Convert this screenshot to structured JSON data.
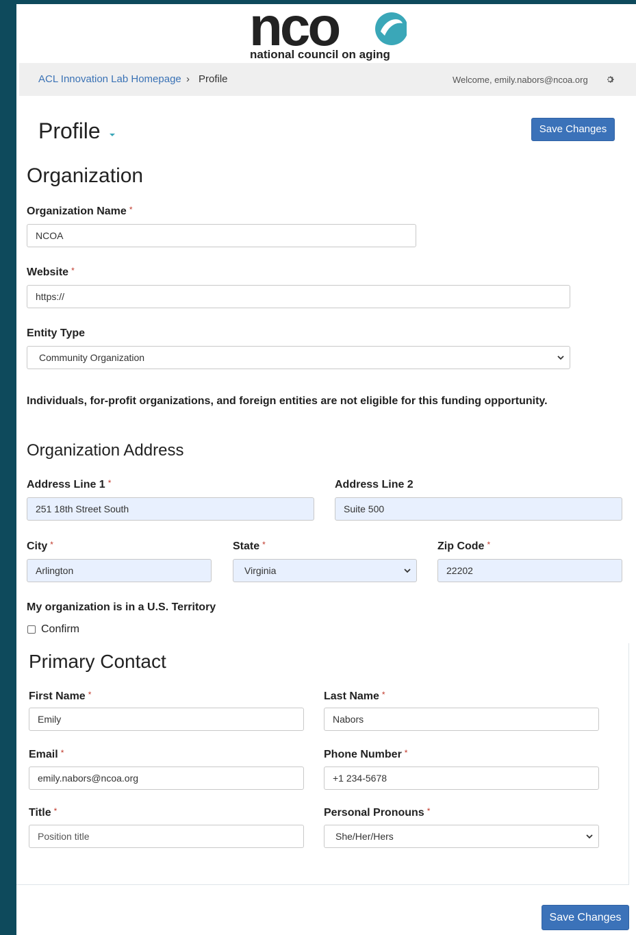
{
  "brand": {
    "logo_text": "nco",
    "tagline": "national council on aging",
    "accent_color": "#3aa7b8",
    "primary_color": "#3b72b9",
    "background_color": "#0e4a5c"
  },
  "navbar": {
    "breadcrumb_home": "ACL Innovation Lab Homepage",
    "breadcrumb_separator": "›",
    "breadcrumb_current": "Profile",
    "welcome_text": "Welcome, emily.nabors@ncoa.org",
    "settings_icon": "gear-icon"
  },
  "page": {
    "title": "Profile",
    "save_label": "Save Changes"
  },
  "organization": {
    "heading": "Organization",
    "name_label": "Organization Name",
    "name_value": "NCOA",
    "website_label": "Website",
    "website_value": "https://",
    "entity_label": "Entity Type",
    "entity_value": "Community Organization",
    "eligibility_note": "Individuals, for-profit organizations, and foreign entities are not eligible for this funding opportunity."
  },
  "address": {
    "heading": "Organization Address",
    "line1_label": "Address Line 1",
    "line1_value": "251 18th Street South",
    "line2_label": "Address Line 2",
    "line2_value": "Suite 500",
    "city_label": "City",
    "city_value": "Arlington",
    "state_label": "State",
    "state_value": "Virginia",
    "zip_label": "Zip Code",
    "zip_value": "22202",
    "territory_label": "My organization is in a U.S. Territory",
    "confirm_label": "Confirm"
  },
  "contact": {
    "heading": "Primary Contact",
    "first_label": "First Name",
    "first_value": "Emily",
    "last_label": "Last Name",
    "last_value": "Nabors",
    "email_label": "Email",
    "email_value": "emily.nabors@ncoa.org",
    "phone_label": "Phone Number",
    "phone_value": "+1 234-5678",
    "title_label": "Title",
    "title_placeholder": "Position title",
    "pronouns_label": "Personal Pronouns",
    "pronouns_value": "She/Her/Hers"
  },
  "required_marker": "*"
}
